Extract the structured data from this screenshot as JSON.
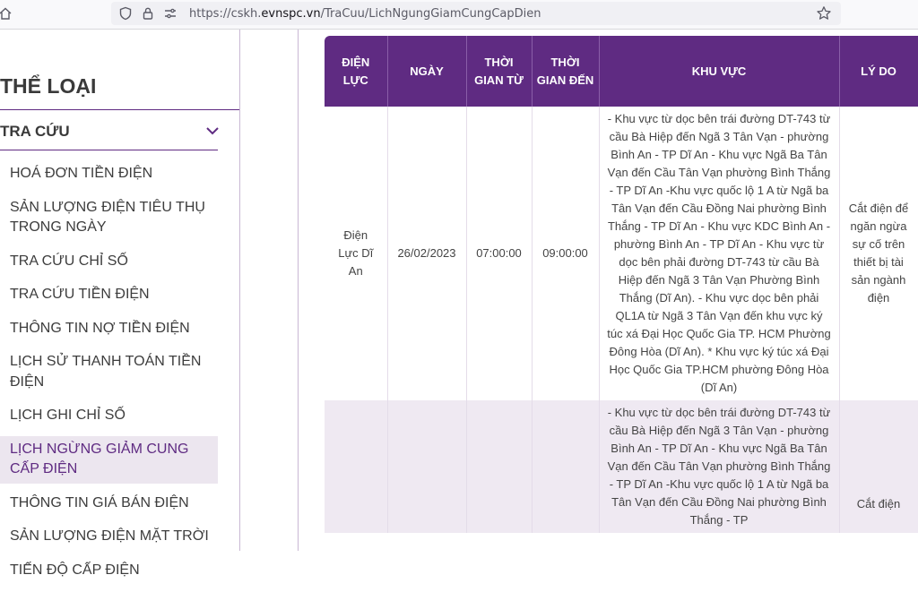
{
  "browser": {
    "url_prefix": "https://cskh.",
    "url_domain": "evnspc.vn",
    "url_path": "/TraCuu/LichNgungGiamCungCapDien"
  },
  "sidebar": {
    "category_title": "THỂ LOẠI",
    "section_title": "TRA CỨU",
    "items": [
      {
        "label": "HOÁ ĐƠN TIỀN ĐIỆN"
      },
      {
        "label": "SẢN LƯỢNG ĐIỆN TIÊU THỤ TRONG NGÀY"
      },
      {
        "label": "TRA CỨU CHỈ SỐ"
      },
      {
        "label": "TRA CỨU TIỀN ĐIỆN"
      },
      {
        "label": "THÔNG TIN NỢ TIỀN ĐIỆN"
      },
      {
        "label": "LỊCH SỬ THANH TOÁN TIỀN ĐIỆN"
      },
      {
        "label": "LỊCH GHI CHỈ SỐ"
      },
      {
        "label": "LỊCH NGỪNG GIẢM CUNG CẤP ĐIỆN"
      },
      {
        "label": "THÔNG TIN GIÁ BÁN ĐIỆN"
      },
      {
        "label": "SẢN LƯỢNG ĐIỆN MẶT TRỜI"
      },
      {
        "label": "TIẾN ĐỘ CẤP ĐIỆN"
      }
    ]
  },
  "table": {
    "headers": [
      "ĐIỆN LỰC",
      "NGÀY",
      "THỜI GIAN TỪ",
      "THỜI GIAN ĐẾN",
      "KHU VỰC",
      "LÝ DO"
    ],
    "rows": [
      {
        "unit": "Điện Lực Dĩ An",
        "date": "26/02/2023",
        "from": "07:00:00",
        "to": "09:00:00",
        "area": "- Khu vực từ dọc bên trái đường DT-743 từ cầu Bà Hiệp đến Ngã 3 Tân Vạn - phường Bình An - TP Dĩ An - Khu vực Ngã Ba Tân Vạn đến Cầu Tân Vạn phường Bình Thắng - TP Dĩ An -Khu vực quốc lộ 1 A từ Ngã ba Tân Vạn đến Cầu Đồng Nai phường Bình Thắng - TP Dĩ An - Khu vực KDC Bình An - phường Bình An - TP Dĩ An - Khu vực từ dọc bên phải đường DT-743 từ cầu Bà Hiệp đến Ngã 3 Tân Vạn Phường Bình Thắng (Dĩ An). - Khu vực dọc bên phải QL1A từ Ngã 3 Tân Vạn đến khu vực ký túc xá Đại Học Quốc Gia TP. HCM Phường Đông Hòa (Dĩ An). * Khu vực ký túc xá Đại Học Quốc Gia TP.HCM phường Đông Hòa (Dĩ An)",
        "reason": "Cắt điện để ngăn ngừa sự cố trên thiết bị tài sản ngành điện"
      },
      {
        "unit": "",
        "date": "",
        "from": "",
        "to": "",
        "area": "- Khu vực từ dọc bên trái đường DT-743 từ cầu Bà Hiệp đến Ngã 3 Tân Vạn - phường Bình An - TP Dĩ An - Khu vực Ngã Ba Tân Vạn đến Cầu Tân Vạn phường Bình Thắng - TP Dĩ An -Khu vực quốc lộ 1 A từ Ngã ba Tân Vạn đến Cầu Đồng Nai phường Bình Thắng - TP",
        "reason": "Cắt điện"
      }
    ]
  }
}
